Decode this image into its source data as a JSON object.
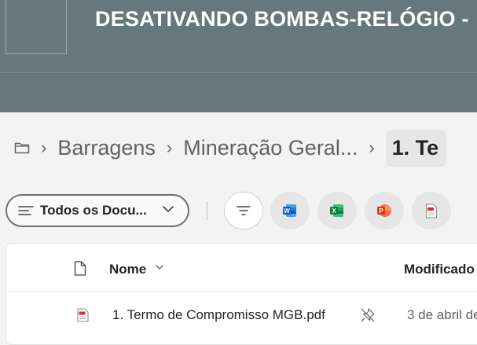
{
  "banner": {
    "title": "DESATIVANDO BOMBAS-RELÓGIO -"
  },
  "breadcrumb": {
    "items": [
      "Barragens",
      "Mineração Geral..."
    ],
    "current": "1. Te",
    "separator": "›"
  },
  "toolbar": {
    "view_label": "Todos os Docu...",
    "new_file_buttons": [
      "Word",
      "Excel",
      "PowerPoint",
      "PDF"
    ]
  },
  "filelist": {
    "columns": {
      "name": "Nome",
      "modified": "Modificado"
    },
    "rows": [
      {
        "name": "1. Termo de Compromisso MGB.pdf",
        "modified": "3 de abril de"
      }
    ]
  },
  "colors": {
    "banner_bg": "#66787d",
    "page_bg": "#f3f3f3",
    "word": "#185abd",
    "excel": "#107c41",
    "powerpoint": "#c43e1c",
    "pdf": "#d13438"
  }
}
